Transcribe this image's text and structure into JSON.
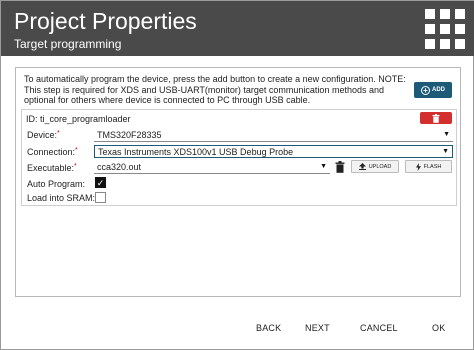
{
  "header": {
    "title": "Project Properties",
    "subtitle": "Target programming",
    "menu_icon": "grid-icon"
  },
  "description": "To automatically program the device, press the add button to create a new configuration. NOTE: This step is required for XDS and USB-UART(monitor) target communication methods and optional for others where device is connected to PC through USB cable.",
  "add_button": {
    "label": "ADD",
    "icon": "plus-circle-icon"
  },
  "config": {
    "id_text": "ID: ti_core_programloader",
    "delete_icon": "trash-icon",
    "device": {
      "label": "Device:",
      "required_mark": "*",
      "value": "TMS320F28335"
    },
    "connection": {
      "label": "Connection:",
      "required_mark": "*",
      "value": "Texas Instruments XDS100v1 USB Debug Probe"
    },
    "executable": {
      "label": "Executable:",
      "required_mark": "*",
      "value": "cca320.out"
    },
    "upload_label": "UPLOAD",
    "flash_label": "FLASH",
    "auto_program": {
      "label": "Auto Program:",
      "checked": true
    },
    "load_sram": {
      "label": "Load into SRAM:",
      "checked": false
    }
  },
  "footer": {
    "back": "BACK",
    "next": "NEXT",
    "cancel": "CANCEL",
    "ok": "OK"
  },
  "colors": {
    "header_bg": "#4a4a4a",
    "primary": "#1d5a78",
    "danger": "#d32f2f"
  }
}
